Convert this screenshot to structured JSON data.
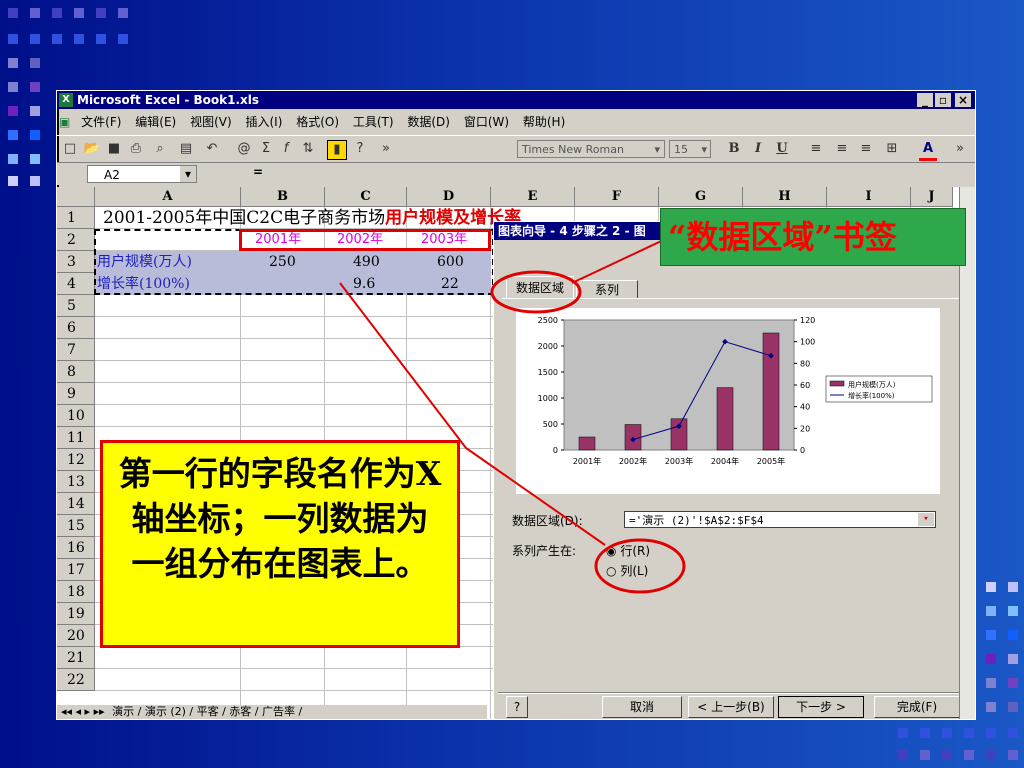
{
  "window": {
    "title": "Microsoft Excel - Book1.xls"
  },
  "menu": [
    "文件(F)",
    "编辑(E)",
    "视图(V)",
    "插入(I)",
    "格式(O)",
    "工具(T)",
    "数据(D)",
    "窗口(W)",
    "帮助(H)"
  ],
  "toolbar": {
    "font": "Times New Roman",
    "size": "15",
    "bold": "B",
    "italic": "I",
    "underline": "U"
  },
  "formula": {
    "namebox": "A2",
    "equals": "="
  },
  "columns": [
    "A",
    "B",
    "C",
    "D",
    "E",
    "F",
    "G",
    "H",
    "I",
    "J"
  ],
  "rows": [
    "1",
    "2",
    "3",
    "4",
    "5",
    "6",
    "7",
    "8",
    "9",
    "10",
    "11",
    "12",
    "13",
    "14",
    "15",
    "16",
    "17",
    "18",
    "19",
    "20",
    "21",
    "22"
  ],
  "sheet": {
    "title_black": "2001-2005年中国C2C电子商务市场",
    "title_red": "用户规模及增长率",
    "years": [
      "2001年",
      "2002年",
      "2003年"
    ],
    "row3_label": "用户规模(万人)",
    "row3_values": [
      "250",
      "490",
      "600"
    ],
    "row4_label": "增长率(100%)",
    "row4_values": [
      "9.6",
      "22"
    ],
    "tabs": "演示 / 演示 (2) / 平客 / 赤客 / 广告率 /"
  },
  "dialog": {
    "title": "图表向导 - 4 步骤之 2 - 图",
    "tab_data_range": "数据区域",
    "tab_series": "系列",
    "range_label": "数据区域(D):",
    "range_value": "='演示 (2)'!$A$2:$F$4",
    "series_label": "系列产生在:",
    "opt_row": "行(R)",
    "opt_col": "列(L)",
    "btn_cancel": "取消",
    "btn_back": "< 上一步(B)",
    "btn_next": "下一步 >",
    "btn_finish": "完成(F)",
    "help": "?"
  },
  "chart_data": {
    "type": "bar",
    "categories": [
      "2001年",
      "2002年",
      "2003年",
      "2004年",
      "2005年"
    ],
    "series": [
      {
        "name": "用户规模(万人)",
        "type": "bar",
        "values": [
          250,
          490,
          600,
          1200,
          2250
        ],
        "axis": "left"
      },
      {
        "name": "增长率(100%)",
        "type": "line",
        "values": [
          null,
          9.6,
          22,
          100,
          87
        ],
        "axis": "right"
      }
    ],
    "ylim_left": [
      0,
      2500
    ],
    "ylim_right": [
      0,
      120
    ],
    "left_ticks": [
      "0",
      "500",
      "1000",
      "1500",
      "2000",
      "2500"
    ],
    "right_ticks": [
      "0",
      "20",
      "40",
      "60",
      "80",
      "100",
      "120"
    ],
    "legend": "right",
    "colors": {
      "bar": "#993366",
      "line": "#000080"
    }
  },
  "callouts": {
    "tag": "“数据区域”书签",
    "note": "第一行的字段名作为X轴坐标；一列数据为一组分布在图表上。"
  },
  "colors": {
    "slide_bg": "#0a2fa8",
    "callout_red": "#ff0000",
    "note_bg": "#ffff00",
    "tag_bg": "#2ea84a"
  }
}
